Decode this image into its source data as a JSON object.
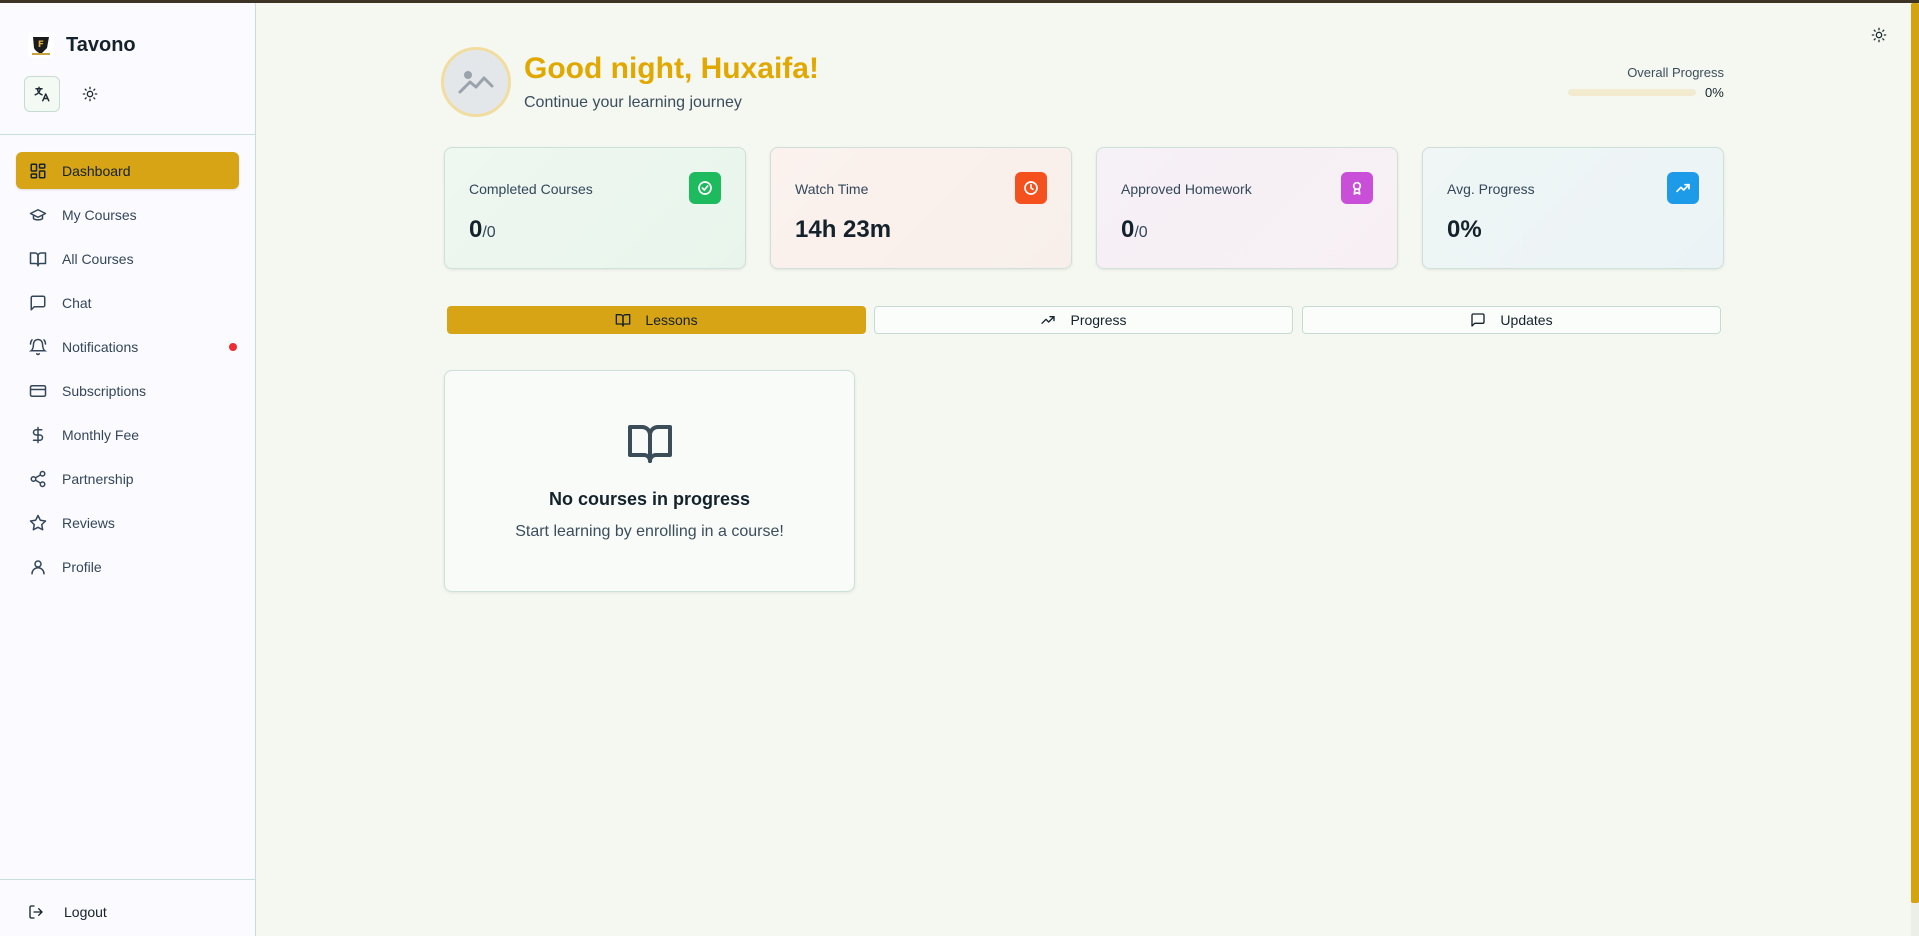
{
  "brand": {
    "name": "Tavono",
    "logo_icon": "tavono-logo"
  },
  "colors": {
    "accent": "#d6a414",
    "greeting": "#e0a800",
    "notification": "#ef2b34"
  },
  "sidebar": {
    "items": [
      {
        "label": "Dashboard",
        "icon": "dashboard-icon",
        "active": true
      },
      {
        "label": "My Courses",
        "icon": "graduation-cap-icon"
      },
      {
        "label": "All Courses",
        "icon": "book-open-icon"
      },
      {
        "label": "Chat",
        "icon": "message-square-icon"
      },
      {
        "label": "Notifications",
        "icon": "bell-icon",
        "has_dot": true
      },
      {
        "label": "Subscriptions",
        "icon": "credit-card-icon"
      },
      {
        "label": "Monthly Fee",
        "icon": "dollar-icon"
      },
      {
        "label": "Partnership",
        "icon": "share-icon"
      },
      {
        "label": "Reviews",
        "icon": "star-icon"
      },
      {
        "label": "Profile",
        "icon": "user-icon"
      }
    ],
    "logout_label": "Logout"
  },
  "header": {
    "greeting": "Good night, Huxaifa!",
    "subtitle": "Continue your learning journey",
    "overall_progress_label": "Overall Progress",
    "overall_progress_value": "0%",
    "overall_progress_fraction": 0
  },
  "stats": [
    {
      "label": "Completed Courses",
      "value": "0",
      "suffix": "/0",
      "icon": "check-circle-icon",
      "color": "#1dbb5e"
    },
    {
      "label": "Watch Time",
      "value": "14h 23m",
      "suffix": "",
      "icon": "clock-icon",
      "color": "#f4511e"
    },
    {
      "label": "Approved Homework",
      "value": "0",
      "suffix": "/0",
      "icon": "award-icon",
      "color": "#c94fd8"
    },
    {
      "label": "Avg. Progress",
      "value": "0%",
      "suffix": "",
      "icon": "trending-up-icon",
      "color": "#1e9be8"
    }
  ],
  "tabs": [
    {
      "label": "Lessons",
      "icon": "book-open-icon",
      "active": true
    },
    {
      "label": "Progress",
      "icon": "trending-up-icon"
    },
    {
      "label": "Updates",
      "icon": "message-square-icon"
    }
  ],
  "empty_state": {
    "title": "No courses in progress",
    "subtitle": "Start learning by enrolling in a course!"
  }
}
